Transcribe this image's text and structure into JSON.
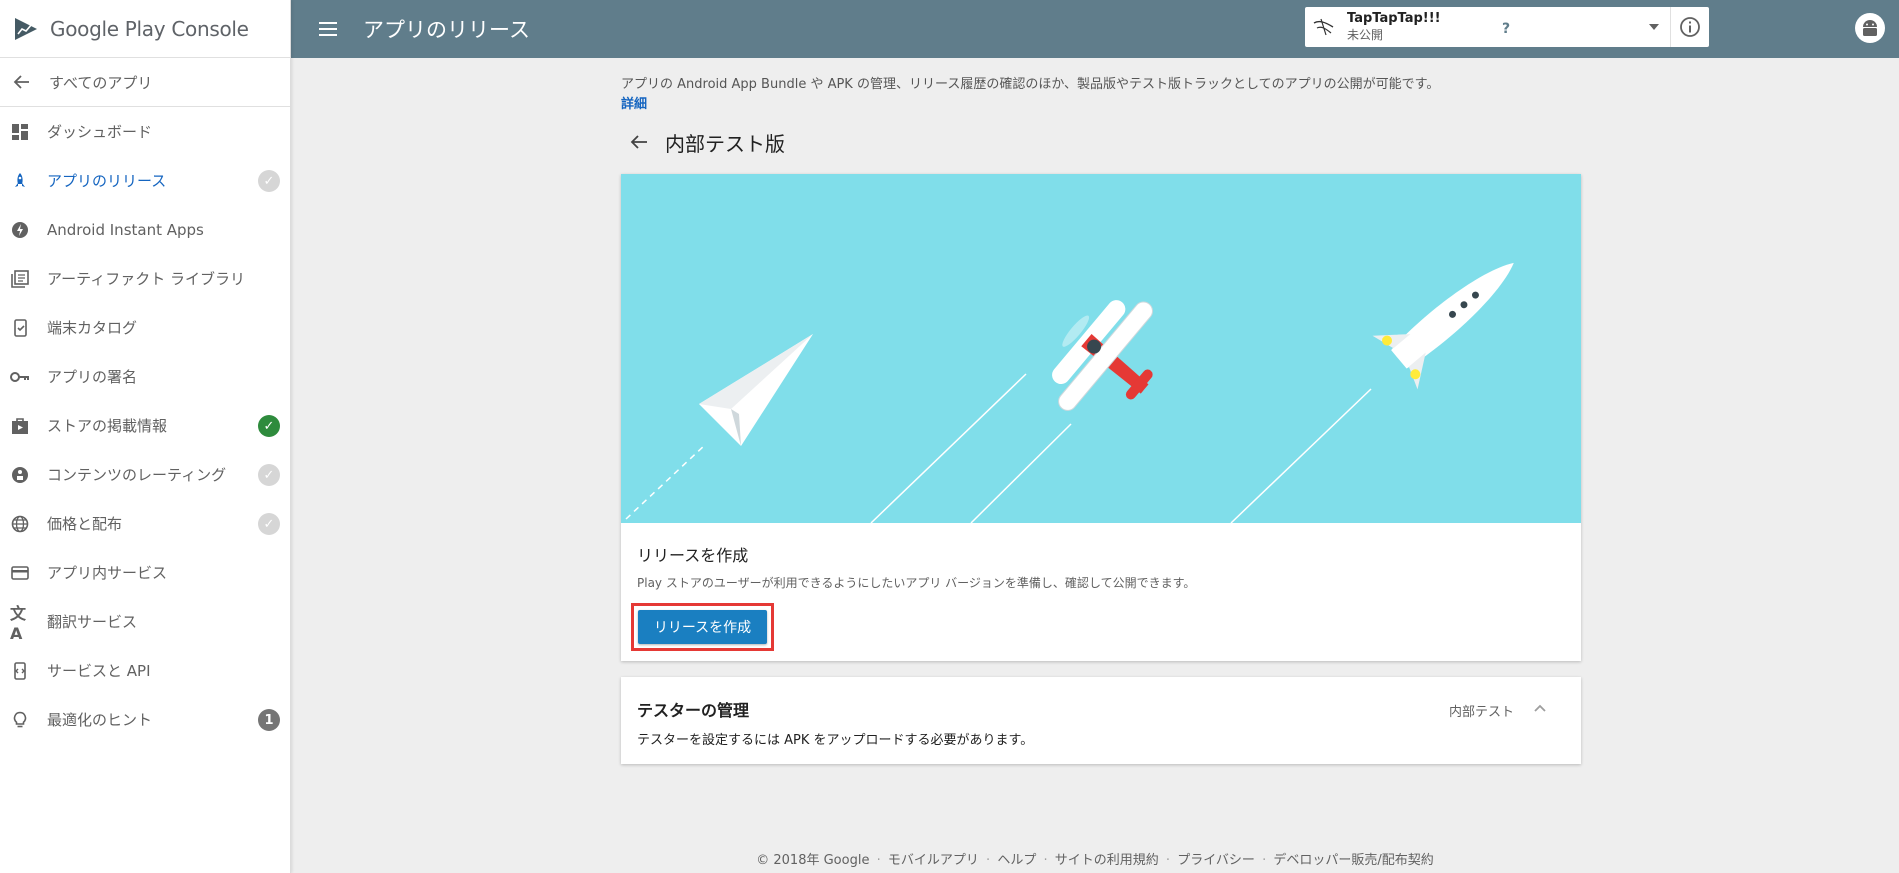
{
  "brand": {
    "google": "Google Play",
    "console": "Console"
  },
  "sidebar": {
    "all_apps": "すべてのアプリ",
    "items": [
      {
        "label": "ダッシュボード",
        "icon": "dashboard-icon"
      },
      {
        "label": "アプリのリリース",
        "icon": "rocket-icon",
        "active": true,
        "status": "grey-check"
      },
      {
        "label": "Android Instant Apps",
        "icon": "lightning-icon"
      },
      {
        "label": "アーティファクト ライブラリ",
        "icon": "library-icon"
      },
      {
        "label": "端末カタログ",
        "icon": "device-catalog-icon"
      },
      {
        "label": "アプリの署名",
        "icon": "key-icon"
      },
      {
        "label": "ストアの掲載情報",
        "icon": "store-listing-icon",
        "status": "green-check"
      },
      {
        "label": "コンテンツのレーティング",
        "icon": "rating-icon",
        "status": "grey-check"
      },
      {
        "label": "価格と配布",
        "icon": "globe-icon",
        "status": "grey-check"
      },
      {
        "label": "アプリ内サービス",
        "icon": "credit-card-icon"
      },
      {
        "label": "翻訳サービス",
        "icon": "translate-icon"
      },
      {
        "label": "サービスと API",
        "icon": "api-icon"
      },
      {
        "label": "最適化のヒント",
        "icon": "lightbulb-icon",
        "badge": "1"
      }
    ]
  },
  "topbar": {
    "title": "アプリのリリース",
    "app_name": "TapTapTap!!!",
    "app_status": "未公開"
  },
  "main": {
    "intro": "アプリの Android App Bundle や APK の管理、リリース履歴の確認のほか、製品版やテスト版トラックとしてのアプリの公開が可能です。",
    "learn_more": "詳細",
    "section_title": "内部テスト版",
    "release_card": {
      "title": "リリースを作成",
      "description": "Play ストアのユーザーが利用できるようにしたいアプリ バージョンを準備し、確認して公開できます。",
      "button": "リリースを作成"
    },
    "testers_card": {
      "title": "テスターの管理",
      "description": "テスターを設定するには APK をアップロードする必要があります。",
      "tag": "内部テスト"
    }
  },
  "footer": {
    "copyright": "© 2018年 Google",
    "links": [
      "モバイルアプリ",
      "ヘルプ",
      "サイトの利用規約",
      "プライバシー",
      "デベロッパー販売/配布契約"
    ]
  },
  "colors": {
    "topbar": "#607d8b",
    "accent": "#1565c0",
    "button": "#1a7fc1",
    "hero_bg": "#80deea",
    "highlight": "#e53935",
    "success": "#2e8b3d"
  }
}
